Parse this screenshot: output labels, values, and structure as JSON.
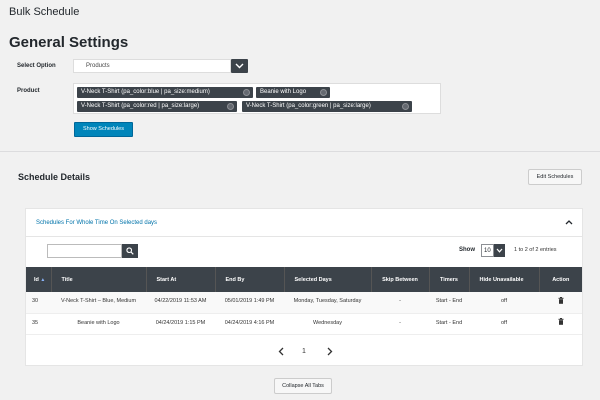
{
  "page": {
    "title": "Bulk Schedule",
    "section_title": "General Settings"
  },
  "form": {
    "select_option_label": "Select Option",
    "select_option_value": "Products",
    "product_label": "Product",
    "products": [
      "V-Neck T-Shirt (pa_color:blue | pa_size:medium)",
      "Beanie with Logo",
      "V-Neck T-Shirt (pa_color:red | pa_size:large)",
      "V-Neck T-Shirt (pa_color:green | pa_size:large)"
    ],
    "show_schedules_label": "Show Schedules"
  },
  "schedule": {
    "title": "Schedule Details",
    "edit_label": "Edit Schedules",
    "panel_title": "Schedules For Whole Time On Selected days",
    "show_label": "Show",
    "show_value": "10",
    "info": "1 to 2 of 2 entries",
    "columns": [
      "Id",
      "Title",
      "Start At",
      "End By",
      "Selected Days",
      "Skip Between",
      "Timers",
      "Hide Unavailable",
      "Action"
    ],
    "rows": [
      {
        "id": "30",
        "title": "V-Neck T-Shirt – Blue, Medium",
        "start": "04/22/2019 11:53 AM",
        "end": "05/01/2019 1:49 PM",
        "days": "Monday, Tuesday, Saturday",
        "skip": "-",
        "timers": "Start - End",
        "hide": "off"
      },
      {
        "id": "35",
        "title": "Beanie with Logo",
        "start": "04/24/2019 1:15 PM",
        "end": "04/24/2019 4:16 PM",
        "days": "Wednesday",
        "skip": "-",
        "timers": "Start - End",
        "hide": "off"
      }
    ],
    "page_number": "1",
    "collapse_label": "Collapse All Tabs"
  },
  "colors": {
    "accent": "#0085ba",
    "dark": "#3c434a",
    "link": "#0073aa"
  },
  "icons": [
    "chevron-down-icon",
    "remove-chip-icon",
    "search-icon",
    "sort-asc-icon",
    "trash-icon",
    "chevron-left-icon",
    "chevron-right-icon",
    "chevron-up-icon"
  ]
}
